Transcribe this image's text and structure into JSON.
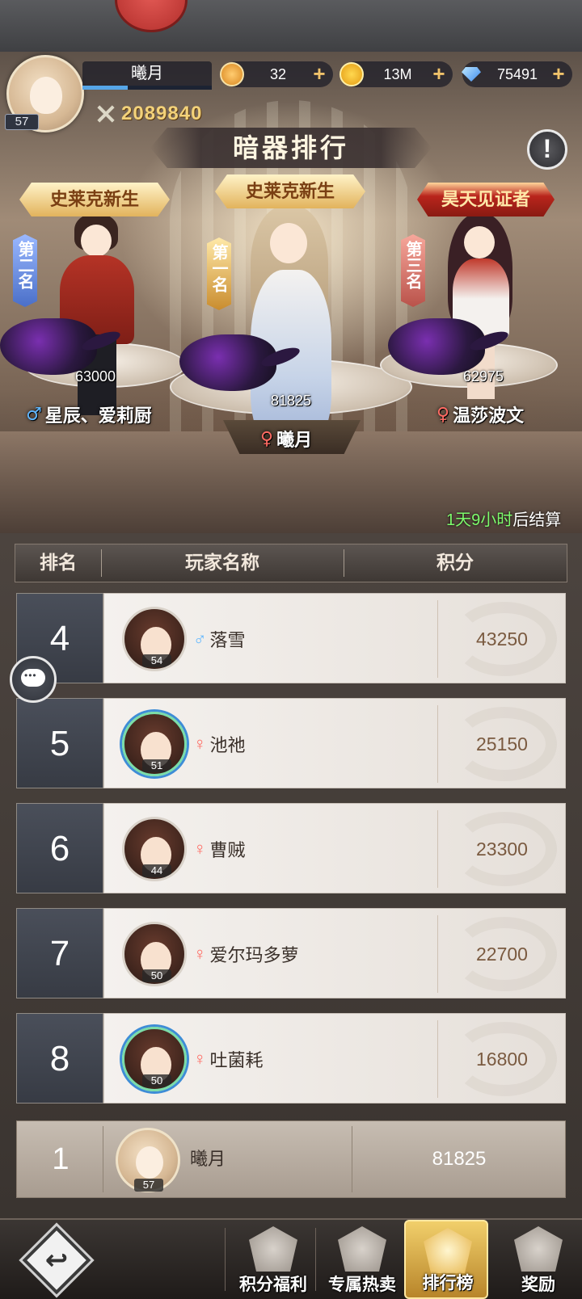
{
  "player": {
    "name": "曦月",
    "level": "57",
    "power": "2089840",
    "exp_fraction": 0.35
  },
  "resources": [
    {
      "icon": "medal-icon",
      "value": "32"
    },
    {
      "icon": "coin-icon",
      "value": "13M"
    },
    {
      "icon": "diamond-icon",
      "value": "75491"
    }
  ],
  "page_title": "暗器排行",
  "podium": {
    "first": {
      "title": "史莱克新生",
      "place": "第一名",
      "score": "81825",
      "sex": "♀",
      "name": "曦月"
    },
    "second": {
      "title": "史莱克新生",
      "place": "第二名",
      "score": "63000",
      "sex": "♂",
      "name": "星辰、爱莉厨"
    },
    "third": {
      "title": "昊天见证者",
      "place": "第三名",
      "score": "62975",
      "sex": "♀",
      "name": "温莎波文"
    }
  },
  "timer": {
    "remaining": "1天9小时",
    "suffix": "后结算"
  },
  "table": {
    "headers": {
      "rank": "排名",
      "name": "玩家名称",
      "score": "积分"
    },
    "rows": [
      {
        "rank": "4",
        "level": "54",
        "sex": "♂",
        "name": "落雪",
        "score": "43250"
      },
      {
        "rank": "5",
        "level": "51",
        "sex": "♀",
        "name": "池祂",
        "score": "25150"
      },
      {
        "rank": "6",
        "level": "44",
        "sex": "♀",
        "name": "曹贼",
        "score": "23300"
      },
      {
        "rank": "7",
        "level": "50",
        "sex": "♀",
        "name": "爱尔玛多萝",
        "score": "22700"
      },
      {
        "rank": "8",
        "level": "50",
        "sex": "♀",
        "name": "吐菌耗",
        "score": "16800"
      }
    ]
  },
  "my_rank": {
    "rank": "1",
    "level": "57",
    "name": "曦月",
    "score": "81825"
  },
  "nav": {
    "back": "↩",
    "tabs": [
      "积分福利",
      "专属热卖",
      "排行榜",
      "奖励"
    ]
  },
  "colors": {
    "accent_gold": "#f3d27a",
    "male": "#5fb6ff",
    "female": "#ff6b63",
    "timer_green": "#7dfb6c"
  }
}
